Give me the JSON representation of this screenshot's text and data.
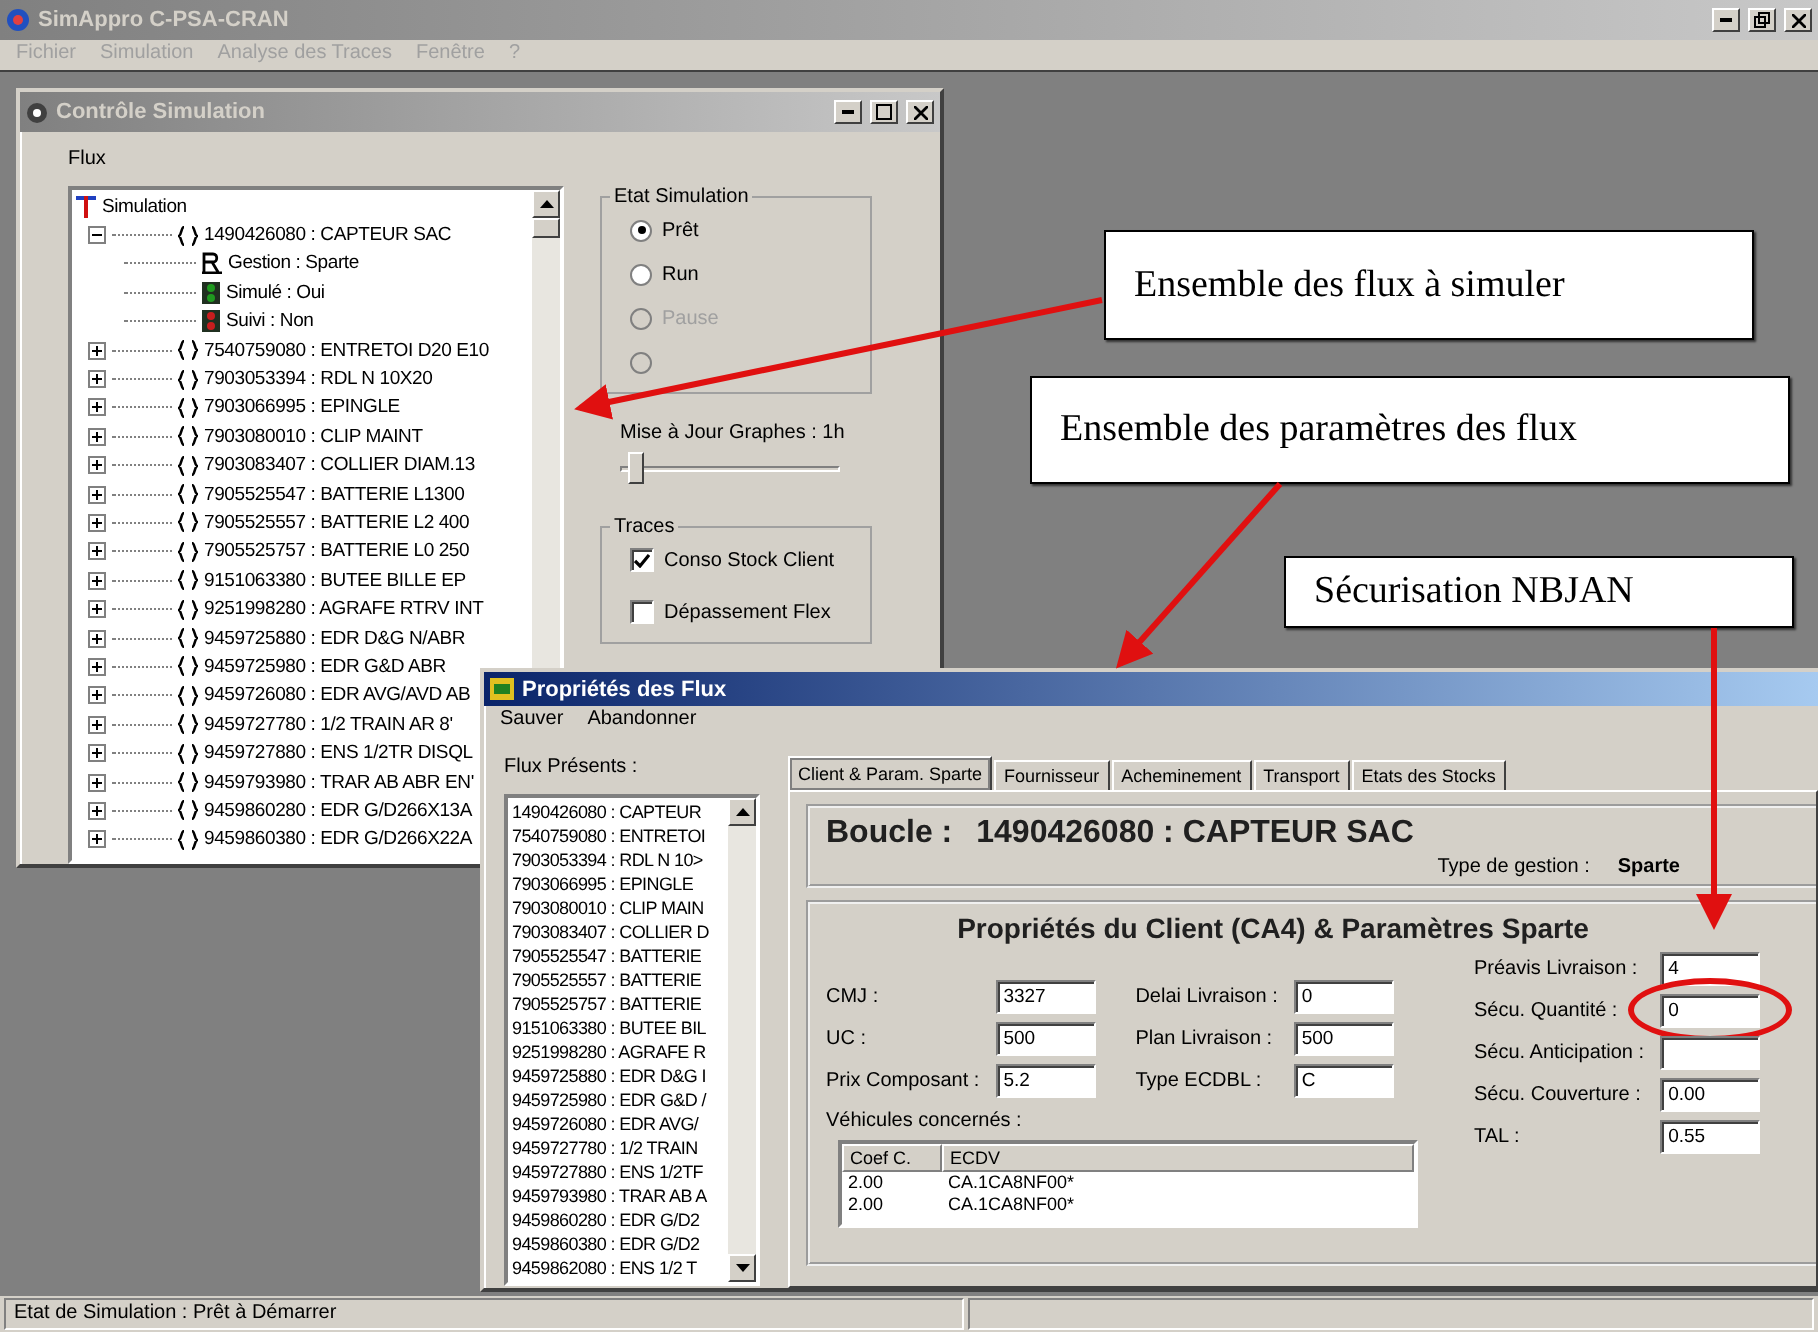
{
  "app": {
    "title": "SimAppro C-PSA-CRAN",
    "menu": [
      "Fichier",
      "Simulation",
      "Analyse des Traces",
      "Fenêtre",
      "?"
    ]
  },
  "control_window": {
    "title": "Contrôle Simulation",
    "flux_label": "Flux",
    "tree": {
      "label": "Simulation",
      "children": [
        {
          "label": "1490426080 : CAPTEUR SAC",
          "expanded": true,
          "children": [
            {
              "kind": "gestion",
              "label": "Gestion : Sparte"
            },
            {
              "kind": "light",
              "label": "Simulé : Oui",
              "color": "#1f9a1f"
            },
            {
              "kind": "light",
              "label": "Suivi : Non",
              "color": "#c81e1e"
            }
          ]
        },
        {
          "label": "7540759080 : ENTRETOI D20 E10",
          "expanded": false
        },
        {
          "label": "7903053394 : RDL N 10X20",
          "expanded": false
        },
        {
          "label": "7903066995 : EPINGLE",
          "expanded": false
        },
        {
          "label": "7903080010 : CLIP MAINT",
          "expanded": false
        },
        {
          "label": "7903083407 : COLLIER DIAM.13",
          "expanded": false
        },
        {
          "label": "7905525547 : BATTERIE L1300",
          "expanded": false
        },
        {
          "label": "7905525557 : BATTERIE L2 400",
          "expanded": false
        },
        {
          "label": "7905525757 : BATTERIE L0 250",
          "expanded": false
        },
        {
          "label": "9151063380 : BUTEE BILLE EP",
          "expanded": false
        },
        {
          "label": "9251998280 : AGRAFE RTRV INT",
          "expanded": false
        },
        {
          "label": "9459725880 : EDR D&G N/ABR",
          "expanded": false
        },
        {
          "label": "9459725980 : EDR G&D ABR",
          "expanded": false
        },
        {
          "label": "9459726080 : EDR AVG/AVD AB",
          "expanded": false
        },
        {
          "label": "9459727780 : 1/2 TRAIN AR 8'",
          "expanded": false
        },
        {
          "label": "9459727880 : ENS 1/2TR DISQL",
          "expanded": false
        },
        {
          "label": "9459793980 : TRAR AB ABR EN'",
          "expanded": false
        },
        {
          "label": "9459860280 : EDR G/D266X13A",
          "expanded": false
        },
        {
          "label": "9459860380 : EDR G/D266X22A",
          "expanded": false
        }
      ]
    },
    "etat": {
      "title": "Etat Simulation",
      "options": [
        {
          "label": "Prêt",
          "selected": true,
          "disabled": false
        },
        {
          "label": "Run",
          "selected": false,
          "disabled": false
        },
        {
          "label": "Pause",
          "selected": false,
          "disabled": true
        },
        {
          "selected": false,
          "disabled": true
        }
      ]
    },
    "slider": {
      "label": "Mise à Jour Graphes : 1h",
      "level": 0.05
    },
    "traces": {
      "title": "Traces",
      "items": [
        {
          "label": "Conso Stock Client",
          "checked": true
        },
        {
          "label": "Dépassement Flex",
          "checked": false
        }
      ]
    }
  },
  "dialog": {
    "title": "Propriétés des Flux",
    "menu": [
      "Sauver",
      "Abandonner"
    ],
    "list_label": "Flux Présents :",
    "list": [
      "1490426080 : CAPTEUR",
      "7540759080 : ENTRETOI",
      "7903053394 : RDL N 10>",
      "7903066995 : EPINGLE",
      "7903080010 : CLIP MAIN",
      "7903083407 : COLLIER D",
      "7905525547 : BATTERIE",
      "7905525557 : BATTERIE",
      "7905525757 : BATTERIE",
      "9151063380 : BUTEE BIL",
      "9251998280 : AGRAFE R",
      "9459725880 : EDR D&G I",
      "9459725980 : EDR G&D /",
      "9459726080 : EDR AVG/",
      "9459727780 : 1/2 TRAIN",
      "9459727880 : ENS 1/2TF",
      "9459793980 : TRAR AB A",
      "9459860280 : EDR G/D2",
      "9459860380 : EDR G/D2",
      "9459862080 : ENS 1/2 T"
    ],
    "tabs": [
      {
        "label": "Client & Param. Sparte",
        "selected": true
      },
      {
        "label": "Fournisseur",
        "selected": false
      },
      {
        "label": "Acheminement",
        "selected": false
      },
      {
        "label": "Transport",
        "selected": false
      },
      {
        "label": "Etats des Stocks",
        "selected": false
      }
    ],
    "boucle": {
      "label": "Boucle :",
      "value": "1490426080 : CAPTEUR SAC",
      "type_label": "Type de gestion :",
      "type_value": "Sparte"
    },
    "props_title": "Propriétés du Client (CA4) & Paramètres Sparte",
    "columns": [
      [
        {
          "label": "CMJ :",
          "value": "3327"
        },
        {
          "label": "UC :",
          "value": "500"
        },
        {
          "label": "Prix Composant :",
          "value": "5.2"
        }
      ],
      [
        {
          "label": "Delai Livraison :",
          "value": "0"
        },
        {
          "label": "Plan Livraison :",
          "value": "500"
        },
        {
          "label": "Type ECDBL :",
          "value": "C"
        }
      ],
      [
        {
          "label": "Préavis Livraison :",
          "value": "4"
        },
        {
          "label": "Sécu. Quantité :",
          "value": "0",
          "highlighted": true
        },
        {
          "label": "Sécu. Anticipation :"
        },
        {
          "label": "Sécu. Couverture :",
          "value": "0.00"
        },
        {
          "label": "TAL :",
          "value": "0.55"
        }
      ]
    ],
    "vehicles": {
      "label": "Véhicules concernés :",
      "columns": [
        "Coef C.",
        "ECDV"
      ],
      "rows": [
        [
          "2.00",
          "CA.1CA8NF00*"
        ],
        [
          "2.00",
          "CA.1CA8NF00*"
        ]
      ]
    }
  },
  "status_bar": "Etat de Simulation : Prêt à Démarrer",
  "annotations": [
    {
      "text": "Ensemble des flux à simuler"
    },
    {
      "text": "Ensemble des paramètres des flux"
    },
    {
      "text": "Sécurisation NBJAN"
    }
  ]
}
